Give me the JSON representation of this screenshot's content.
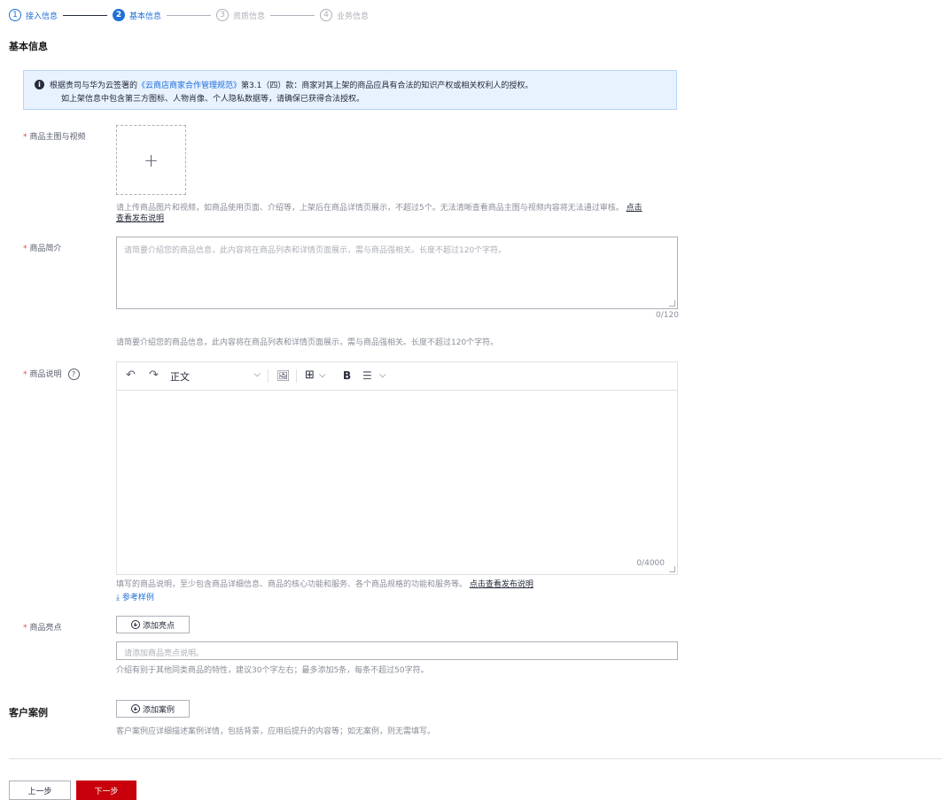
{
  "steps": [
    {
      "num": "1",
      "label": "接入信息",
      "state": "done"
    },
    {
      "num": "2",
      "label": "基本信息",
      "state": "active"
    },
    {
      "num": "3",
      "label": "资质信息",
      "state": "todo"
    },
    {
      "num": "4",
      "label": "业务信息",
      "state": "todo"
    }
  ],
  "basic": {
    "title": "基本信息",
    "notice": {
      "line1_prefix": "根据贵司与华为云签署的",
      "line1_link": "《云商店商家合作管理规范》",
      "line1_suffix": "第3.1（四）款：商家对其上架的商品应具有合法的知识产权或相关权利人的授权。",
      "line2": "如上架信息中包含第三方图标、人物肖像、个人隐私数据等，请确保已获得合法授权。"
    },
    "media": {
      "label": "商品主图与视频",
      "plus": "+",
      "hint_text": "请上传商品图片和视频，如商品使用页面、介绍等，上架后在商品详情页展示，不超过5个。无法清晰查看商品主图与视频内容将无法通过审核。",
      "hint_link_1": "点击",
      "hint_link_2": "查看发布说明"
    },
    "intro": {
      "label": "商品简介",
      "placeholder": "请简要介绍您的商品信息，此内容将在商品列表和详情页面展示，需与商品强相关。长度不超过120个字符。",
      "counter": "0/120",
      "hint": "请简要介绍您的商品信息，此内容将在商品列表和详情页面展示，需与商品强相关。长度不超过120个字符。"
    },
    "desc": {
      "label": "商品说明",
      "help": "?",
      "toolbar": {
        "undo": "↶",
        "redo": "↷",
        "style_value": "正文",
        "chevron": "⌵",
        "image": "🖼",
        "table": "⊞",
        "bold": "B",
        "list": "☰"
      },
      "counter": "0/4000",
      "hint_text": "填写的商品说明，至少包含商品详细信息、商品的核心功能和服务、各个商品规格的功能和服务等。",
      "hint_link": "点击查看发布说明",
      "ref_link": "⤓ 参考样例"
    },
    "highlights": {
      "label": "商品亮点",
      "button": "添加亮点",
      "placeholder": "请添加商品亮点说明。",
      "hint": "介绍有别于其他同类商品的特性，建议30个字左右；最多添加5条，每条不超过50字符。"
    }
  },
  "cases": {
    "title": "客户案例",
    "button": "添加案例",
    "hint": "客户案例应详细描述案例详情，包括背景，应用后提升的内容等；如无案例，则无需填写。"
  },
  "footer": {
    "prev": "上一步",
    "next": "下一步"
  },
  "colors": {
    "accent": "#1e6fd9",
    "primary_button": "#c7000b",
    "required": "#e54545",
    "notice_bg": "#e8f2ff"
  }
}
